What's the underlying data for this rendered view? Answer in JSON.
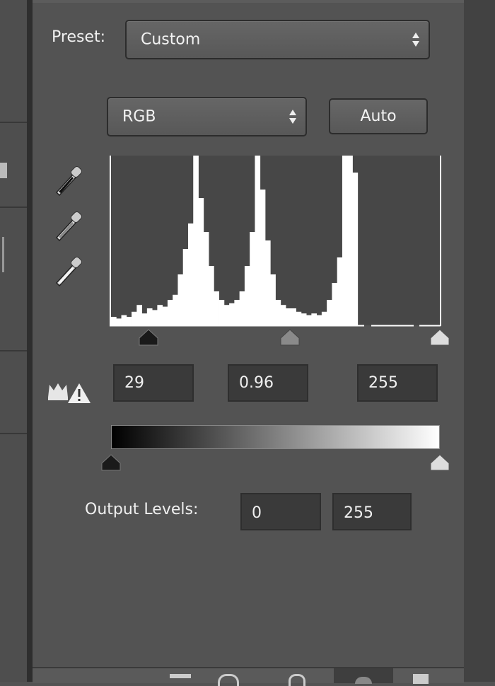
{
  "preset": {
    "label": "Preset:",
    "value": "Custom"
  },
  "channel": {
    "value": "RGB"
  },
  "auto_button": "Auto",
  "eyedroppers": [
    "black-point-eyedropper",
    "gray-point-eyedropper",
    "white-point-eyedropper"
  ],
  "input_levels": {
    "black": "29",
    "gamma": "0.96",
    "white": "255"
  },
  "output_levels": {
    "label": "Output Levels:",
    "black": "0",
    "white": "255"
  },
  "colors": {
    "panel": "#535353",
    "field": "#3a3a3a",
    "histogram_bg": "#474747",
    "histogram_fill": "#ffffff"
  },
  "chart_data": {
    "type": "bar",
    "description_type": "histogram",
    "xlim": [
      0,
      255
    ],
    "ylim": [
      0,
      1
    ],
    "bin_width": 4,
    "values": [
      0.05,
      0.04,
      0.06,
      0.05,
      0.08,
      0.12,
      0.07,
      0.1,
      0.09,
      0.12,
      0.11,
      0.15,
      0.18,
      0.3,
      0.45,
      0.6,
      1.0,
      0.75,
      0.55,
      0.35,
      0.2,
      0.15,
      0.12,
      0.13,
      0.15,
      0.2,
      0.35,
      0.55,
      1.0,
      0.8,
      0.5,
      0.3,
      0.15,
      0.12,
      0.1,
      0.1,
      0.08,
      0.07,
      0.06,
      0.07,
      0.06,
      0.08,
      0.15,
      0.25,
      0.4,
      1.0,
      1.0,
      0.9,
      0,
      0,
      0,
      0,
      0,
      0,
      0,
      0,
      0,
      0,
      0,
      0,
      0,
      0,
      0,
      0
    ],
    "input_black": 29,
    "input_gamma": 0.96,
    "input_white": 255,
    "output_black": 0,
    "output_white": 255
  }
}
